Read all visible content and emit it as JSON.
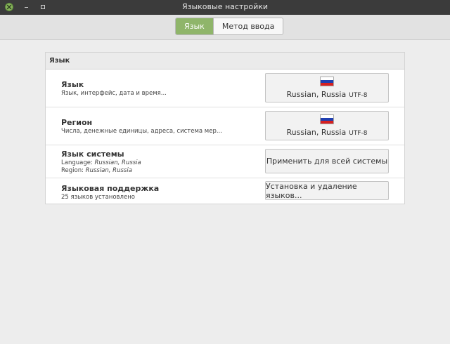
{
  "window": {
    "title": "Языковые настройки"
  },
  "tabs": [
    {
      "label": "Язык",
      "active": true
    },
    {
      "label": "Метод ввода",
      "active": false
    }
  ],
  "panel": {
    "header": "Язык",
    "rows": {
      "language": {
        "title": "Язык",
        "subtitle": "Язык, интерфейс, дата и время...",
        "button_locale": "Russian, Russia",
        "button_encoding": "UTF-8",
        "flag": "russia-flag-icon"
      },
      "region": {
        "title": "Регион",
        "subtitle": "Числа, денежные единицы, адреса, система мер...",
        "button_locale": "Russian, Russia",
        "button_encoding": "UTF-8",
        "flag": "russia-flag-icon"
      },
      "system_language": {
        "title": "Язык системы",
        "language_prefix": "Language:",
        "language_value": "Russian, Russia",
        "region_prefix": "Region:",
        "region_value": "Russian, Russia",
        "button_label": "Применить для всей системы"
      },
      "language_support": {
        "title": "Языковая поддержка",
        "subtitle": "25 языков установлено",
        "button_label": "Установка и удаление языков..."
      }
    }
  },
  "colors": {
    "titlebar": "#3b3b3b",
    "accent": "#8fb56a",
    "close_button": "#86b35b"
  }
}
